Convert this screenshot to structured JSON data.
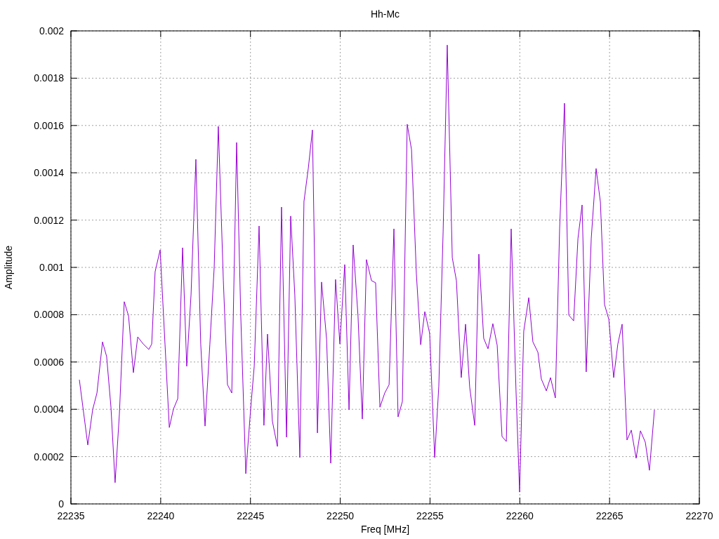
{
  "chart_data": {
    "type": "line",
    "title": "Hh-Mc",
    "grid": true,
    "xlabel": "Freq [MHz]",
    "ylabel": "Amplitude",
    "xlim": [
      22235,
      22270
    ],
    "ylim": [
      0,
      0.002
    ],
    "xticks": [
      22235,
      22240,
      22245,
      22250,
      22255,
      22260,
      22265,
      22270
    ],
    "yticks": [
      {
        "value": 0,
        "label": "0"
      },
      {
        "value": 0.0002,
        "label": "0.0002"
      },
      {
        "value": 0.0004,
        "label": "0.0004"
      },
      {
        "value": 0.0006,
        "label": "0.0006"
      },
      {
        "value": 0.0008,
        "label": "0.0008"
      },
      {
        "value": 0.001,
        "label": "0.001"
      },
      {
        "value": 0.0012,
        "label": "0.0012"
      },
      {
        "value": 0.0014,
        "label": "0.0014"
      },
      {
        "value": 0.0016,
        "label": "0.0016"
      },
      {
        "value": 0.0018,
        "label": "0.0018"
      },
      {
        "value": 0.002,
        "label": "0.002"
      }
    ],
    "x": [
      22235.47,
      22235.94,
      22236.21,
      22236.45,
      22236.76,
      22236.99,
      22237.23,
      22237.46,
      22237.7,
      22237.97,
      22238.21,
      22238.48,
      22238.72,
      22239.03,
      22239.34,
      22239.5,
      22239.69,
      22239.97,
      22240.24,
      22240.48,
      22240.71,
      22240.95,
      22241.22,
      22241.45,
      22241.69,
      22241.96,
      22242.23,
      22242.47,
      22242.74,
      22242.98,
      22243.21,
      22243.49,
      22243.72,
      22243.96,
      22244.23,
      22244.46,
      22244.74,
      22245.01,
      22245.21,
      22245.48,
      22245.75,
      22245.95,
      22246.22,
      22246.5,
      22246.73,
      22247.01,
      22247.24,
      22247.47,
      22247.75,
      22247.98,
      22248.22,
      22248.45,
      22248.73,
      22248.96,
      22249.24,
      22249.47,
      22249.74,
      22249.98,
      22250.25,
      22250.49,
      22250.72,
      22250.99,
      22251.23,
      22251.46,
      22251.74,
      22251.97,
      22252.21,
      22252.48,
      22252.72,
      22252.99,
      22253.22,
      22253.46,
      22253.73,
      22253.97,
      22254.24,
      22254.48,
      22254.71,
      22254.98,
      22255.26,
      22255.49,
      22255.73,
      22255.96,
      22256.24,
      22256.47,
      22256.74,
      22256.98,
      22257.21,
      22257.49,
      22257.72,
      22257.99,
      22258.23,
      22258.5,
      22258.74,
      22259.01,
      22259.25,
      22259.52,
      22259.79,
      22259.99,
      22260.22,
      22260.5,
      22260.73,
      22261.01,
      22261.2,
      22261.48,
      22261.71,
      22261.98,
      22262.22,
      22262.49,
      22262.73,
      22263.0,
      22263.24,
      22263.47,
      22263.7,
      22263.98,
      22264.25,
      22264.49,
      22264.72,
      22264.96,
      22265.23,
      22265.46,
      22265.7,
      22265.97,
      22266.21,
      22266.48,
      22266.72,
      22266.99,
      22267.22,
      22267.5
    ],
    "series": [
      {
        "color": "#9400d3",
        "values": [
          0.000525,
          0.000249,
          0.000398,
          0.000469,
          0.000685,
          0.000623,
          0.000409,
          9e-05,
          0.00038,
          0.000855,
          0.000795,
          0.000555,
          0.000706,
          0.000676,
          0.000653,
          0.000676,
          0.000982,
          0.001074,
          0.000676,
          0.000323,
          0.000401,
          0.000445,
          0.001083,
          0.000582,
          0.000884,
          0.001457,
          0.000676,
          0.000329,
          0.000676,
          0.001,
          0.001596,
          0.000944,
          0.000504,
          0.000469,
          0.001528,
          0.000795,
          0.000128,
          0.000401,
          0.000582,
          0.001175,
          0.000332,
          0.000718,
          0.00035,
          0.000243,
          0.001255,
          0.000282,
          0.001217,
          0.000884,
          0.000196,
          0.001279,
          0.001418,
          0.001581,
          0.0003,
          0.000938,
          0.000697,
          0.000172,
          0.000949,
          0.000676,
          0.001012,
          0.000398,
          0.001095,
          0.000795,
          0.000359,
          0.001033,
          0.000944,
          0.000935,
          0.000409,
          0.000469,
          0.000504,
          0.001163,
          0.000368,
          0.000433,
          0.001605,
          0.001498,
          0.000973,
          0.000673,
          0.000813,
          0.000721,
          0.000196,
          0.000498,
          0.001151,
          0.00194,
          0.001041,
          0.000944,
          0.000534,
          0.00076,
          0.000493,
          0.000332,
          0.001056,
          0.0007,
          0.000656,
          0.000762,
          0.000671,
          0.000285,
          0.000264,
          0.001163,
          0.000478,
          5e-05,
          0.00073,
          0.000872,
          0.000685,
          0.000641,
          0.000528,
          0.000478,
          0.000534,
          0.000448,
          0.001166,
          0.001694,
          0.000798,
          0.000774,
          0.001122,
          0.001264,
          0.000558,
          0.001122,
          0.001418,
          0.001276,
          0.000843,
          0.00078,
          0.000534,
          0.000676,
          0.00076,
          0.00027,
          0.000312,
          0.000193,
          0.000309,
          0.000261,
          0.000142,
          0.000398
        ]
      }
    ]
  }
}
